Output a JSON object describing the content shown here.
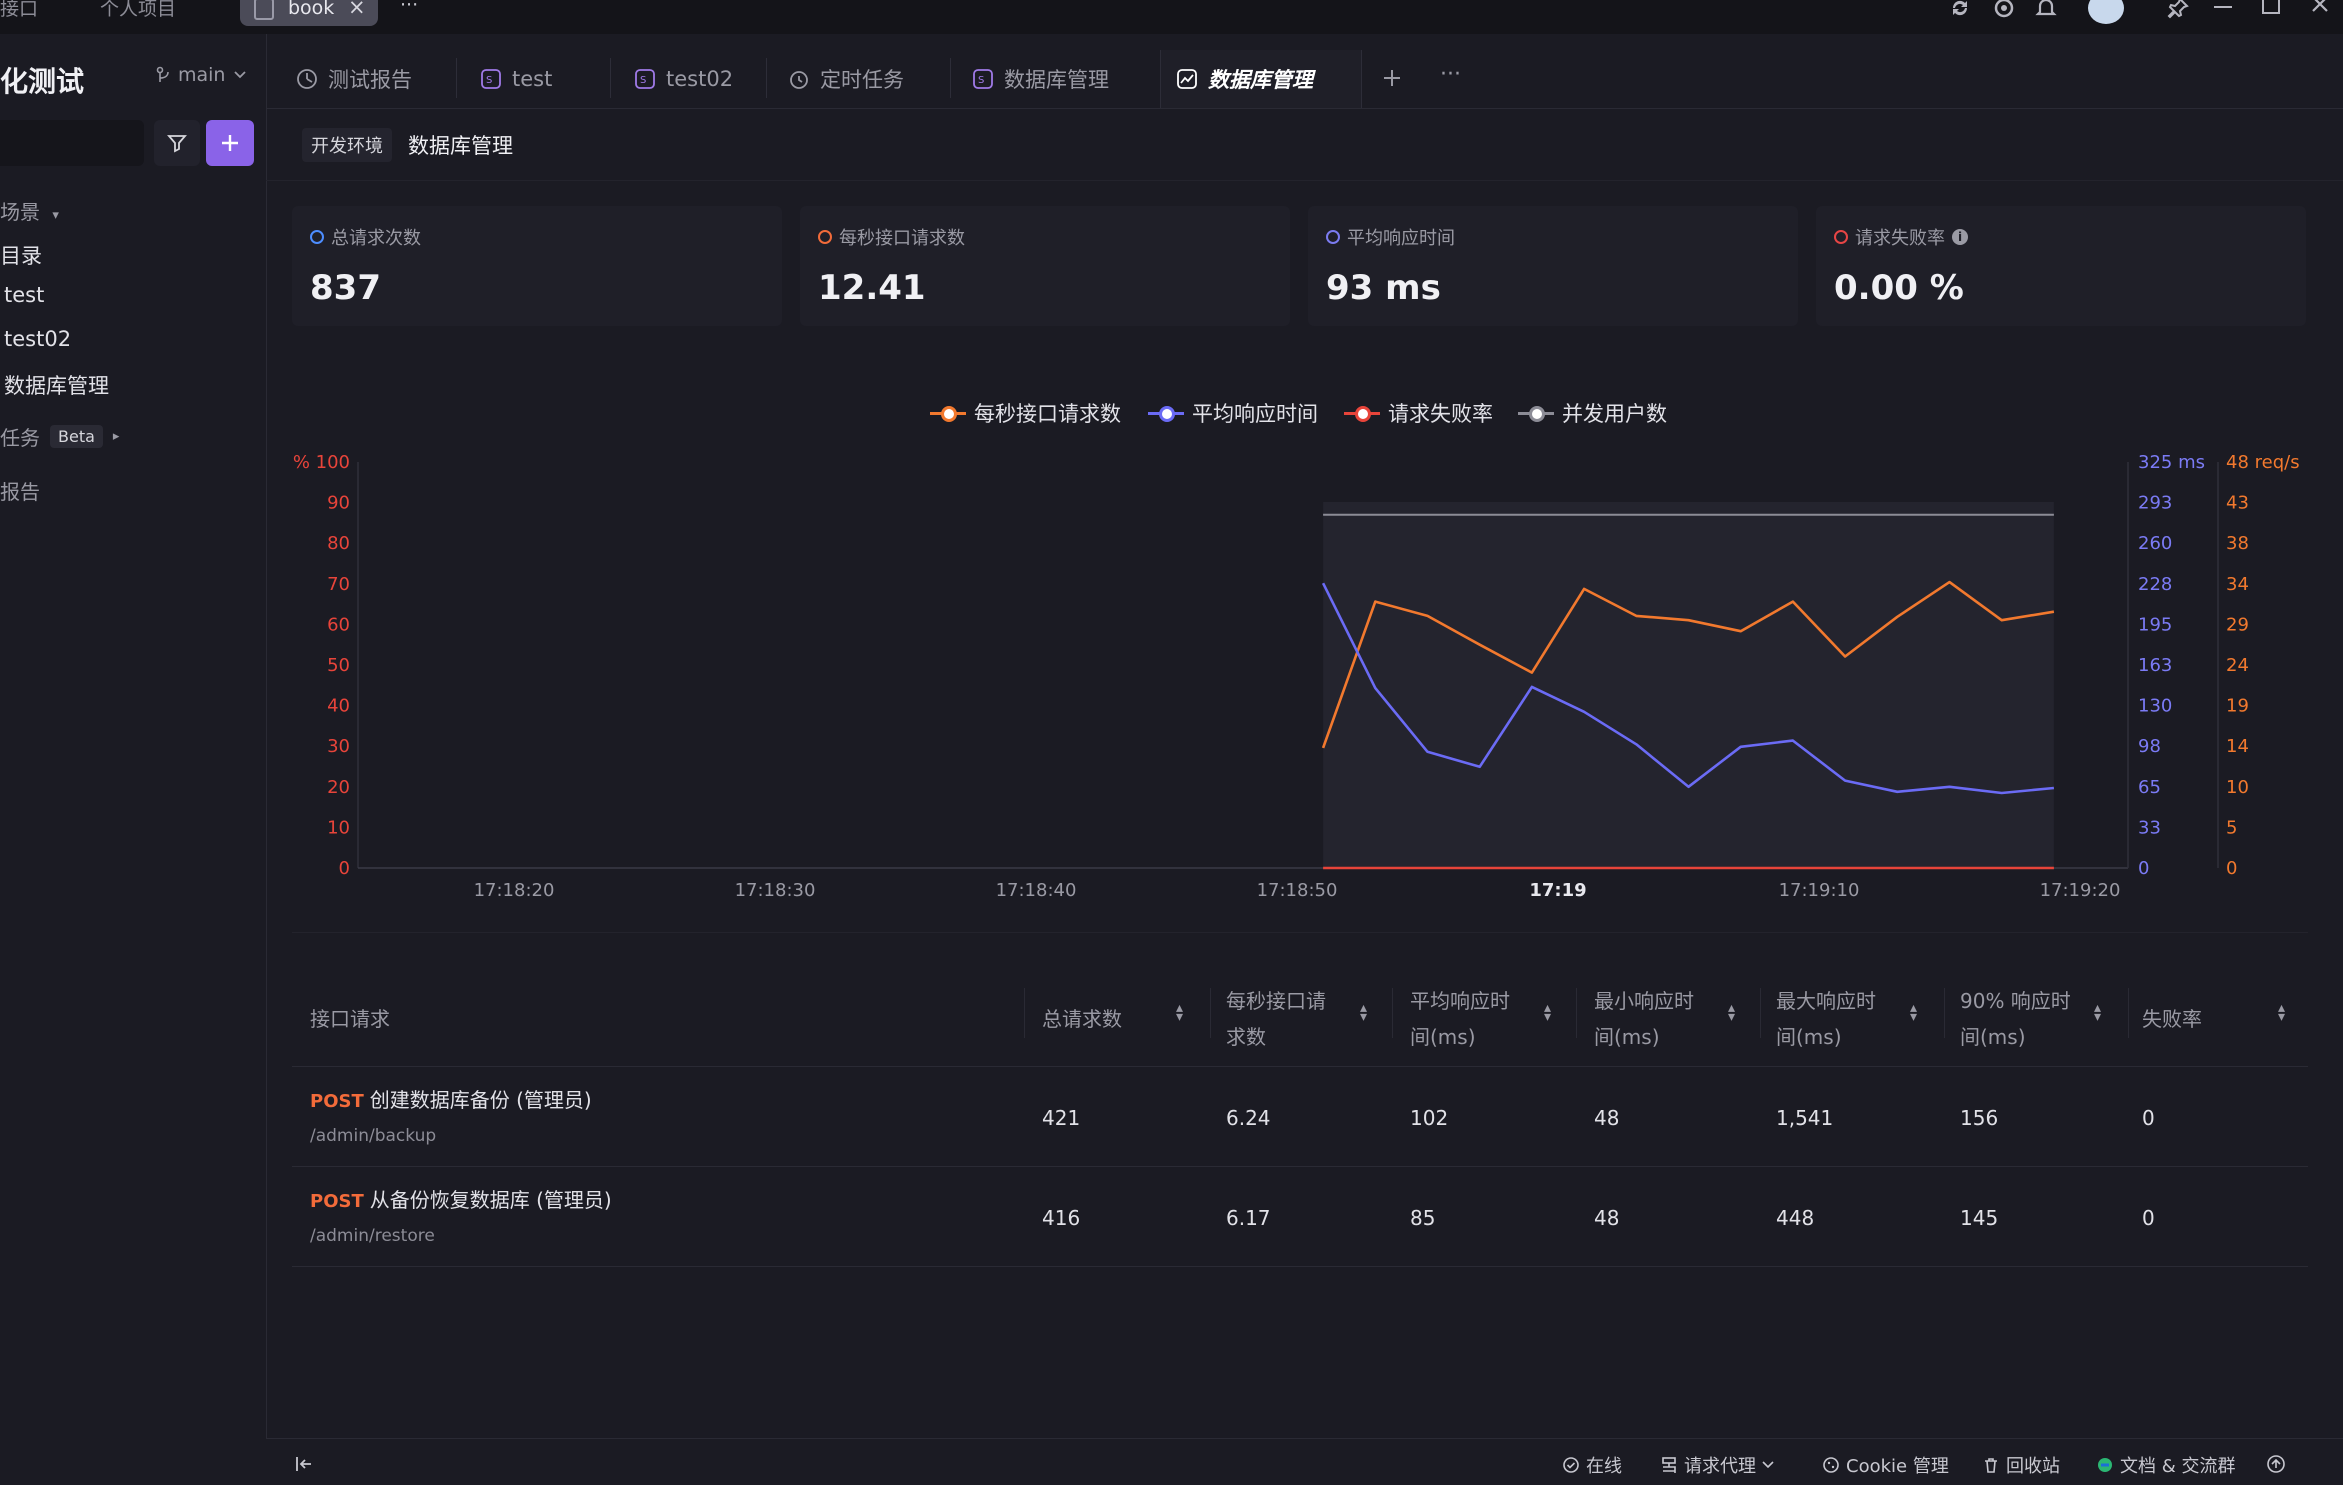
{
  "topbar": {
    "left_text": "接口",
    "project_tab": "个人项目",
    "book_tab": "book",
    "close_glyph": "×",
    "more": "···"
  },
  "sidebar": {
    "title": "化测试",
    "branch": "main",
    "items": [
      {
        "label": "场景",
        "dim": true
      },
      {
        "label": "目录"
      },
      {
        "label": "test"
      },
      {
        "label": "test02"
      },
      {
        "label": "数据库管理"
      },
      {
        "label": "任务",
        "badge": "Beta",
        "dim": true
      },
      {
        "label": "报告",
        "dim": true
      }
    ]
  },
  "tabs": [
    {
      "label": "测试报告",
      "icon": "report-icon"
    },
    {
      "label": "test",
      "icon": "api-icon"
    },
    {
      "label": "test02",
      "icon": "api-icon"
    },
    {
      "label": "定时任务",
      "icon": "clock-icon"
    },
    {
      "label": "数据库管理",
      "icon": "api-icon"
    },
    {
      "label": "数据库管理",
      "icon": "chart-icon",
      "active": true
    }
  ],
  "breadcrumb": {
    "env": "开发环境",
    "title": "数据库管理"
  },
  "cards": [
    {
      "label": "总请求次数",
      "value": "837",
      "color": "#4d8dff"
    },
    {
      "label": "每秒接口请求数",
      "value": "12.41",
      "color": "#f26b3a"
    },
    {
      "label": "平均响应时间",
      "value": "93 ms",
      "color": "#7b7bf0"
    },
    {
      "label": "请求失败率",
      "value": "0.00 %",
      "color": "#e64545"
    }
  ],
  "legend": [
    {
      "label": "每秒接口请求数",
      "color": "#f2792e"
    },
    {
      "label": "平均响应时间",
      "color": "#6b6bf5"
    },
    {
      "label": "请求失败率",
      "color": "#e8443a"
    },
    {
      "label": "并发用户数",
      "color": "#8c8c96"
    }
  ],
  "chart_data": {
    "type": "line",
    "x": [
      "17:18:51",
      "17:18:53",
      "17:18:55",
      "17:18:57",
      "17:18:59",
      "17:19:01",
      "17:19:03",
      "17:19:05",
      "17:19:07",
      "17:19:09",
      "17:19:11",
      "17:19:13",
      "17:19:15",
      "17:19:17",
      "17:19:19"
    ],
    "x_ticks": [
      "17:18:20",
      "17:18:30",
      "17:18:40",
      "17:18:50",
      "17:19",
      "17:19:10",
      "17:19:20"
    ],
    "left_axis": {
      "unit": "%",
      "ticks": [
        "100",
        "90",
        "80",
        "70",
        "60",
        "50",
        "40",
        "30",
        "20",
        "10",
        "0"
      ],
      "ylim": [
        0,
        100
      ]
    },
    "right_axis_ms": {
      "unit": "ms",
      "ticks": [
        "325",
        "293",
        "260",
        "228",
        "195",
        "163",
        "130",
        "98",
        "65",
        "33",
        "0"
      ],
      "ylim": [
        0,
        325
      ]
    },
    "right_axis_req": {
      "unit": "req/s",
      "ticks": [
        "48",
        "43",
        "38",
        "34",
        "29",
        "24",
        "19",
        "14",
        "10",
        "5",
        "0"
      ],
      "ylim": [
        0,
        48
      ]
    },
    "series": [
      {
        "name": "每秒接口请求数",
        "axis": "req/s",
        "color": "#f2792e",
        "values": [
          14.2,
          31.5,
          29.8,
          26.4,
          23.1,
          33.0,
          29.8,
          29.3,
          28.0,
          31.5,
          25.0,
          29.7,
          33.8,
          29.3,
          30.3
        ]
      },
      {
        "name": "平均响应时间",
        "axis": "ms",
        "color": "#6b6bf5",
        "values": [
          228,
          144,
          93,
          81,
          145,
          125,
          99,
          65,
          97,
          102,
          70,
          61,
          65,
          60,
          64
        ]
      },
      {
        "name": "请求失败率",
        "axis": "%",
        "color": "#e8443a",
        "values": [
          0,
          0,
          0,
          0,
          0,
          0,
          0,
          0,
          0,
          0,
          0,
          0,
          0,
          0,
          0
        ]
      },
      {
        "name": "并发用户数",
        "axis": "%",
        "color": "#8c8c96",
        "values": [
          87,
          87,
          87,
          87,
          87,
          87,
          87,
          87,
          87,
          87,
          87,
          87,
          87,
          87,
          87
        ]
      }
    ],
    "highlight_range": [
      "17:18:51",
      "17:19:19"
    ],
    "grid": false,
    "legend_position": "top-center"
  },
  "table": {
    "headers": [
      {
        "label": "接口请求"
      },
      {
        "label": "总请求数",
        "sortable": true
      },
      {
        "label": "每秒接口请求数",
        "line1": "每秒接口请",
        "line2": "求数",
        "sortable": true
      },
      {
        "label": "平均响应时间(ms)",
        "line1": "平均响应时",
        "line2": "间(ms)",
        "sortable": true
      },
      {
        "label": "最小响应时间(ms)",
        "line1": "最小响应时",
        "line2": "间(ms)",
        "sortable": true
      },
      {
        "label": "最大响应时间(ms)",
        "line1": "最大响应时",
        "line2": "间(ms)",
        "sortable": true
      },
      {
        "label": "90% 响应时间(ms)",
        "line1": "90% 响应时",
        "line2": "间(ms)",
        "sortable": true
      },
      {
        "label": "失败率",
        "sortable": true
      }
    ],
    "rows": [
      {
        "method": "POST",
        "name": "创建数据库备份 (管理员)",
        "path": "/admin/backup",
        "total": "421",
        "rps": "6.24",
        "avg": "102",
        "min": "48",
        "max": "1,541",
        "p90": "156",
        "fail": "0"
      },
      {
        "method": "POST",
        "name": "从备份恢复数据库 (管理员)",
        "path": "/admin/restore",
        "total": "416",
        "rps": "6.17",
        "avg": "85",
        "min": "48",
        "max": "448",
        "p90": "145",
        "fail": "0"
      }
    ]
  },
  "statusbar": {
    "online": "在线",
    "proxy": "请求代理",
    "cookie": "Cookie 管理",
    "recycle": "回收站",
    "docs": "文档 & 交流群"
  }
}
